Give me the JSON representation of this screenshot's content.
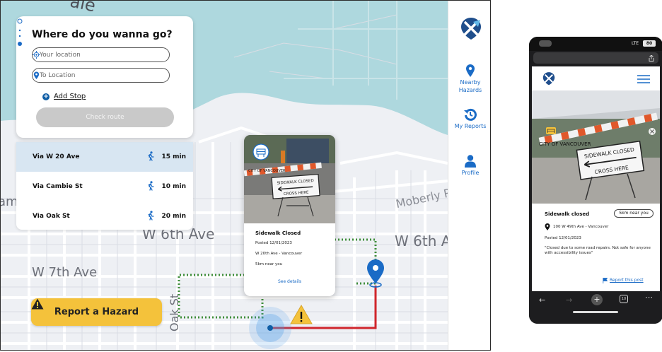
{
  "desktop": {
    "search": {
      "title": "Where do you wanna go?",
      "from_placeholder": "Your location",
      "to_placeholder": "To Location",
      "add_stop": "Add Stop",
      "check_route": "Check route"
    },
    "routes": [
      {
        "name": "Via W 20 Ave",
        "time": "15 min",
        "selected": true
      },
      {
        "name": "Via Cambie St",
        "time": "10 min",
        "selected": false
      },
      {
        "name": "Via Oak St",
        "time": "20 min",
        "selected": false
      }
    ],
    "report_hazard": "Report a Hazard",
    "hazard_card": {
      "title": "Sidewalk Closed",
      "posted": "Posted 12/01/2023",
      "location": "W 20th Ave - Vancouver",
      "distance": "5km near you",
      "link": "See details"
    },
    "map_labels": {
      "w6th_left": "W 6th Ave",
      "w6th_right": "W 6th A",
      "w7th": "W 7th Ave",
      "moberly": "Moberly R",
      "oak": "Oak St",
      "top": "ale",
      "left": "am"
    },
    "nav": [
      {
        "label": "Nearby Hazards",
        "icon": "map-pin-icon"
      },
      {
        "label": "My Reports",
        "icon": "history-icon"
      },
      {
        "label": "Profile",
        "icon": "person-icon"
      }
    ],
    "colors": {
      "brand": "#1a6bc6",
      "accent": "#f4c23b",
      "route_red": "#d0262c",
      "route_green": "#3f8e3a",
      "water": "#aed8de"
    }
  },
  "phone": {
    "status_carrier": "LTE",
    "status_battery": "80",
    "hazard": {
      "title": "Sidewalk closed",
      "distance": "5km near you",
      "address": "100 W 49th Ave - Vancouver",
      "posted": "Posted 12/01/2023",
      "description": "\"Closed due to some road repairs. Not safe for anyone with accessibility issues\"",
      "report": "Report this post"
    },
    "tab_count": "10"
  },
  "sign": {
    "sidewalk_closed": "SIDEWALK CLOSED",
    "cross_here": "CROSS HERE",
    "city": "CITY OF VANCOUVER"
  }
}
